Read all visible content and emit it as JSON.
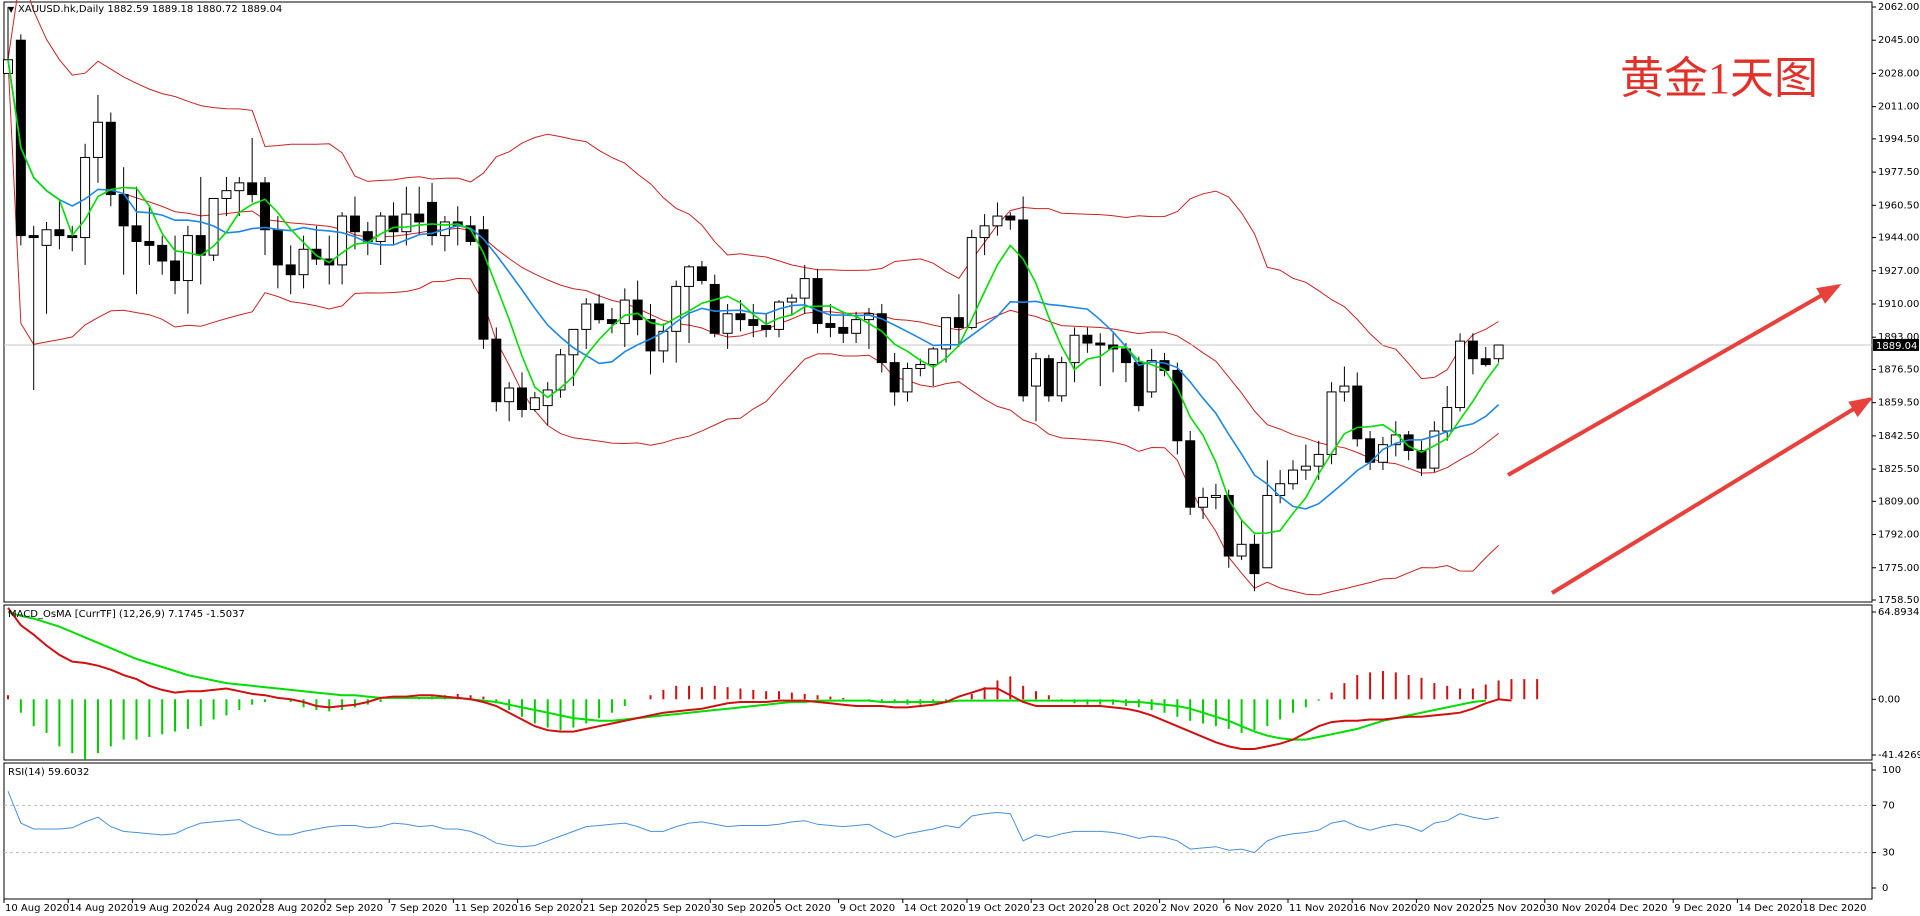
{
  "colors": {
    "background": "#ffffff",
    "bull_candle": "#ffffff",
    "bear_candle": "#000000",
    "ma_fast": "#00dd00",
    "ma_slow": "#1e88e5",
    "bollinger": "#cc2222",
    "macd_signal": "#00dd00",
    "macd_line": "#d01010",
    "histogram_up": "#d01010",
    "histogram_down": "#00cc00",
    "rsi_line": "#4a90d9",
    "arrows": "#e8403a",
    "price_label_bg": "#000000"
  },
  "chart_data": [
    {
      "type": "candlestick",
      "title": "黄金1天图",
      "header": "XAUUSD.hk,Daily  1882.59 1889.18 1880.72 1889.04",
      "current_price": "1889.04",
      "y_ticks": [
        "2062.00",
        "2045.00",
        "2028.00",
        "2011.00",
        "1994.50",
        "1977.50",
        "1960.50",
        "1944.00",
        "1927.00",
        "1910.00",
        "1893.00",
        "1876.50",
        "1859.50",
        "1842.50",
        "1825.50",
        "1809.00",
        "1792.00",
        "1775.00",
        "1758.50"
      ],
      "ylim": [
        1758.5,
        2062
      ],
      "x_labels": [
        "10 Aug 2020",
        "14 Aug 2020",
        "19 Aug 2020",
        "24 Aug 2020",
        "28 Aug 2020",
        "2 Sep 2020",
        "7 Sep 2020",
        "11 Sep 2020",
        "16 Sep 2020",
        "21 Sep 2020",
        "25 Sep 2020",
        "30 Sep 2020",
        "5 Oct 2020",
        "9 Oct 2020",
        "14 Oct 2020",
        "19 Oct 2020",
        "23 Oct 2020",
        "28 Oct 2020",
        "2 Nov 2020",
        "6 Nov 2020",
        "11 Nov 2020",
        "16 Nov 2020",
        "20 Nov 2020",
        "25 Nov 2020",
        "30 Nov 2020",
        "4 Dec 2020",
        "9 Dec 2020",
        "14 Dec 2020",
        "18 Dec 2020"
      ],
      "ohlc": [
        [
          2028,
          2062,
          2028,
          2035
        ],
        [
          2045,
          2048,
          1940,
          1945
        ],
        [
          1945,
          1950,
          1866,
          1944
        ],
        [
          1940,
          1952,
          1905,
          1948
        ],
        [
          1948,
          1963,
          1938,
          1945
        ],
        [
          1945,
          1950,
          1937,
          1944
        ],
        [
          1944,
          1992,
          1930,
          1985
        ],
        [
          1985,
          2017,
          1972,
          2003
        ],
        [
          2003,
          2008,
          1960,
          1966
        ],
        [
          1966,
          1980,
          1925,
          1950
        ],
        [
          1950,
          1970,
          1915,
          1942
        ],
        [
          1942,
          1960,
          1930,
          1940
        ],
        [
          1940,
          1945,
          1925,
          1932
        ],
        [
          1932,
          1945,
          1915,
          1922
        ],
        [
          1922,
          1950,
          1905,
          1945
        ],
        [
          1945,
          1975,
          1920,
          1935
        ],
        [
          1935,
          1962,
          1932,
          1964
        ],
        [
          1964,
          1975,
          1955,
          1968
        ],
        [
          1968,
          1975,
          1955,
          1972
        ],
        [
          1972,
          1995,
          1962,
          1966
        ],
        [
          1972,
          1975,
          1935,
          1948
        ],
        [
          1948,
          1955,
          1918,
          1930
        ],
        [
          1930,
          1940,
          1915,
          1925
        ],
        [
          1925,
          1945,
          1918,
          1938
        ],
        [
          1938,
          1950,
          1930,
          1933
        ],
        [
          1933,
          1945,
          1920,
          1930
        ],
        [
          1930,
          1957,
          1920,
          1955
        ],
        [
          1955,
          1965,
          1938,
          1947
        ],
        [
          1947,
          1952,
          1935,
          1942
        ],
        [
          1942,
          1957,
          1930,
          1955
        ],
        [
          1955,
          1962,
          1940,
          1947
        ],
        [
          1947,
          1970,
          1940,
          1956
        ],
        [
          1956,
          1970,
          1945,
          1952
        ],
        [
          1962,
          1972,
          1940,
          1945
        ],
        [
          1945,
          1955,
          1937,
          1952
        ],
        [
          1952,
          1960,
          1940,
          1950
        ],
        [
          1950,
          1955,
          1940,
          1942
        ],
        [
          1948,
          1955,
          1887,
          1892
        ],
        [
          1892,
          1898,
          1855,
          1860
        ],
        [
          1860,
          1870,
          1850,
          1867
        ],
        [
          1867,
          1875,
          1852,
          1856
        ],
        [
          1856,
          1865,
          1855,
          1862
        ],
        [
          1858,
          1870,
          1848,
          1866
        ],
        [
          1866,
          1887,
          1862,
          1884
        ],
        [
          1884,
          1890,
          1868,
          1897
        ],
        [
          1897,
          1913,
          1887,
          1910
        ],
        [
          1910,
          1915,
          1900,
          1902
        ],
        [
          1902,
          1908,
          1895,
          1900
        ],
        [
          1900,
          1918,
          1888,
          1912
        ],
        [
          1912,
          1922,
          1894,
          1902
        ],
        [
          1902,
          1910,
          1874,
          1886
        ],
        [
          1886,
          1900,
          1880,
          1896
        ],
        [
          1896,
          1922,
          1880,
          1919
        ],
        [
          1919,
          1930,
          1890,
          1929
        ],
        [
          1929,
          1932,
          1920,
          1922
        ],
        [
          1920,
          1925,
          1893,
          1895
        ],
        [
          1895,
          1910,
          1887,
          1905
        ],
        [
          1905,
          1912,
          1896,
          1902
        ],
        [
          1902,
          1910,
          1893,
          1899
        ],
        [
          1899,
          1905,
          1893,
          1897
        ],
        [
          1897,
          1912,
          1893,
          1911
        ],
        [
          1911,
          1915,
          1904,
          1913
        ],
        [
          1913,
          1930,
          1905,
          1923
        ],
        [
          1923,
          1928,
          1895,
          1900
        ],
        [
          1900,
          1910,
          1893,
          1898
        ],
        [
          1898,
          1905,
          1890,
          1895
        ],
        [
          1895,
          1906,
          1890,
          1902
        ],
        [
          1902,
          1908,
          1887,
          1905
        ],
        [
          1905,
          1910,
          1875,
          1880
        ],
        [
          1880,
          1885,
          1858,
          1865
        ],
        [
          1865,
          1880,
          1860,
          1877
        ],
        [
          1877,
          1882,
          1873,
          1879
        ],
        [
          1879,
          1888,
          1868,
          1887
        ],
        [
          1887,
          1903,
          1880,
          1903
        ],
        [
          1903,
          1915,
          1888,
          1898
        ],
        [
          1898,
          1948,
          1897,
          1944
        ],
        [
          1944,
          1956,
          1935,
          1950
        ],
        [
          1950,
          1962,
          1945,
          1955
        ],
        [
          1955,
          1957,
          1948,
          1953
        ],
        [
          1953,
          1965,
          1860,
          1863
        ],
        [
          1868,
          1885,
          1850,
          1882
        ],
        [
          1882,
          1884,
          1860,
          1863
        ],
        [
          1863,
          1883,
          1860,
          1880
        ],
        [
          1880,
          1898,
          1870,
          1894
        ],
        [
          1894,
          1898,
          1885,
          1890
        ],
        [
          1890,
          1895,
          1868,
          1889
        ],
        [
          1889,
          1895,
          1875,
          1887
        ],
        [
          1887,
          1890,
          1870,
          1880
        ],
        [
          1880,
          1883,
          1855,
          1858
        ],
        [
          1865,
          1887,
          1862,
          1881
        ],
        [
          1881,
          1885,
          1873,
          1876
        ],
        [
          1876,
          1880,
          1833,
          1840
        ],
        [
          1840,
          1845,
          1802,
          1806
        ],
        [
          1806,
          1816,
          1800,
          1811
        ],
        [
          1811,
          1818,
          1805,
          1812
        ],
        [
          1812,
          1815,
          1775,
          1781
        ],
        [
          1781,
          1800,
          1779,
          1787
        ],
        [
          1787,
          1792,
          1763,
          1772
        ],
        [
          1775,
          1830,
          1775,
          1812
        ],
        [
          1812,
          1825,
          1808,
          1818
        ],
        [
          1818,
          1830,
          1815,
          1825
        ],
        [
          1825,
          1838,
          1820,
          1827
        ],
        [
          1827,
          1840,
          1820,
          1833
        ],
        [
          1833,
          1870,
          1828,
          1865
        ],
        [
          1865,
          1878,
          1860,
          1868
        ],
        [
          1868,
          1875,
          1837,
          1841
        ],
        [
          1841,
          1845,
          1825,
          1829
        ],
        [
          1829,
          1842,
          1825,
          1838
        ],
        [
          1838,
          1850,
          1832,
          1843
        ],
        [
          1843,
          1845,
          1830,
          1835
        ],
        [
          1835,
          1840,
          1822,
          1826
        ],
        [
          1826,
          1850,
          1824,
          1845
        ],
        [
          1845,
          1868,
          1840,
          1857
        ],
        [
          1857,
          1895,
          1855,
          1891
        ],
        [
          1891,
          1895,
          1874,
          1882
        ],
        [
          1882,
          1888,
          1878,
          1879
        ],
        [
          1882,
          1889,
          1880,
          1889
        ]
      ]
    },
    {
      "type": "histogram_line",
      "header": "MACD_OsMA [CurrTF] (12,26,9) 7.1745 -1.5037",
      "y_ticks": [
        "64.8934",
        "0.00",
        "-41.4269"
      ],
      "ylim": [
        -41.4269,
        64.8934
      ],
      "histogram": [
        3,
        -10,
        -20,
        -25,
        -35,
        -40,
        -45,
        -40,
        -35,
        -30,
        -30,
        -28,
        -26,
        -24,
        -22,
        -20,
        -15,
        -12,
        -8,
        -4,
        -2,
        0,
        -2,
        -6,
        -8,
        -9,
        -8,
        -6,
        -4,
        -2,
        0,
        0,
        1,
        2,
        3,
        4,
        3,
        2,
        -3,
        -8,
        -13,
        -18,
        -21,
        -23,
        -21,
        -18,
        -14,
        -10,
        -5,
        0,
        3,
        7,
        10,
        10,
        9,
        10,
        9,
        8,
        7,
        6,
        6,
        5,
        4,
        3,
        2,
        1,
        0,
        -1,
        -2,
        -3,
        -4,
        -4,
        -3,
        -2,
        0,
        4,
        9,
        14,
        17,
        10,
        6,
        3,
        -1,
        -3,
        -4,
        -4,
        -4,
        -5,
        -6,
        -8,
        -10,
        -13,
        -16,
        -18,
        -20,
        -22,
        -25,
        -23,
        -20,
        -15,
        -10,
        -6,
        -1,
        5,
        12,
        18,
        20,
        21,
        20,
        18,
        16,
        12,
        10,
        8,
        8,
        11,
        14,
        15,
        15,
        15
      ],
      "signal": [
        65,
        62,
        60,
        57,
        54,
        50,
        46,
        42,
        38,
        34,
        30,
        27,
        24,
        21,
        18,
        16,
        14,
        12,
        11,
        10,
        9,
        8,
        7,
        6,
        5,
        4,
        3,
        3,
        2,
        1,
        1,
        1,
        1,
        1,
        1,
        1,
        0,
        -1,
        -2,
        -4,
        -6,
        -8,
        -10,
        -12,
        -14,
        -15,
        -16,
        -16,
        -15,
        -14,
        -13,
        -12,
        -11,
        -10,
        -9,
        -8,
        -7,
        -6,
        -5,
        -4,
        -3,
        -2,
        -2,
        -1,
        -1,
        -1,
        -1,
        -1,
        -2,
        -2,
        -2,
        -2,
        -2,
        -2,
        -1,
        -1,
        -1,
        -1,
        -1,
        -1,
        -1,
        -1,
        -1,
        -1,
        -1,
        -1,
        -1,
        -2,
        -2,
        -3,
        -4,
        -5,
        -7,
        -10,
        -13,
        -16,
        -20,
        -24,
        -27,
        -29,
        -30,
        -30,
        -28,
        -26,
        -24,
        -22,
        -19,
        -16,
        -14,
        -12,
        -10,
        -8,
        -6,
        -4,
        -2,
        -1
      ],
      "macd": [
        68,
        55,
        48,
        40,
        33,
        28,
        27,
        25,
        22,
        18,
        15,
        10,
        7,
        5,
        6,
        6,
        7,
        8,
        6,
        4,
        3,
        1,
        0,
        -2,
        -5,
        -6,
        -5,
        -4,
        -2,
        1,
        2,
        2,
        3,
        3,
        2,
        1,
        0,
        -2,
        -5,
        -10,
        -15,
        -20,
        -23,
        -24,
        -24,
        -22,
        -20,
        -18,
        -16,
        -14,
        -12,
        -10,
        -9,
        -8,
        -7,
        -5,
        -3,
        -2,
        -2,
        -2,
        -1,
        -1,
        -1,
        -2,
        -3,
        -4,
        -5,
        -5,
        -5,
        -6,
        -6,
        -5,
        -4,
        -2,
        2,
        5,
        8,
        8,
        3,
        -2,
        -5,
        -5,
        -5,
        -5,
        -5,
        -5,
        -6,
        -7,
        -9,
        -12,
        -16,
        -20,
        -24,
        -28,
        -32,
        -35,
        -37,
        -37,
        -35,
        -33,
        -30,
        -25,
        -20,
        -17,
        -16,
        -16,
        -15,
        -15,
        -14,
        -13,
        -13,
        -12,
        -11,
        -10,
        -7,
        -3,
        0,
        -1
      ]
    },
    {
      "type": "line",
      "header": "RSI(14) 59.6032",
      "y_ticks": [
        "100",
        "70",
        "30",
        "0"
      ],
      "ylim": [
        0,
        100
      ],
      "values": [
        82,
        55,
        50,
        50,
        50,
        51,
        56,
        60,
        52,
        48,
        47,
        46,
        45,
        46,
        51,
        55,
        56,
        57,
        58,
        52,
        48,
        45,
        45,
        48,
        50,
        52,
        53,
        53,
        51,
        52,
        55,
        54,
        52,
        53,
        50,
        50,
        48,
        44,
        38,
        36,
        35,
        36,
        40,
        44,
        48,
        52,
        53,
        54,
        55,
        52,
        48,
        48,
        52,
        55,
        56,
        54,
        52,
        53,
        53,
        53,
        54,
        56,
        57,
        54,
        53,
        52,
        53,
        54,
        48,
        43,
        46,
        48,
        50,
        53,
        51,
        61,
        63,
        64,
        63,
        40,
        45,
        43,
        46,
        48,
        48,
        48,
        47,
        45,
        42,
        44,
        43,
        40,
        33,
        34,
        35,
        32,
        33,
        30,
        40,
        44,
        46,
        47,
        49,
        55,
        57,
        52,
        49,
        52,
        54,
        52,
        48,
        55,
        57,
        63,
        60,
        58,
        60
      ]
    }
  ],
  "labels": {
    "rsi_header": "RSI(14) 59.6032"
  }
}
